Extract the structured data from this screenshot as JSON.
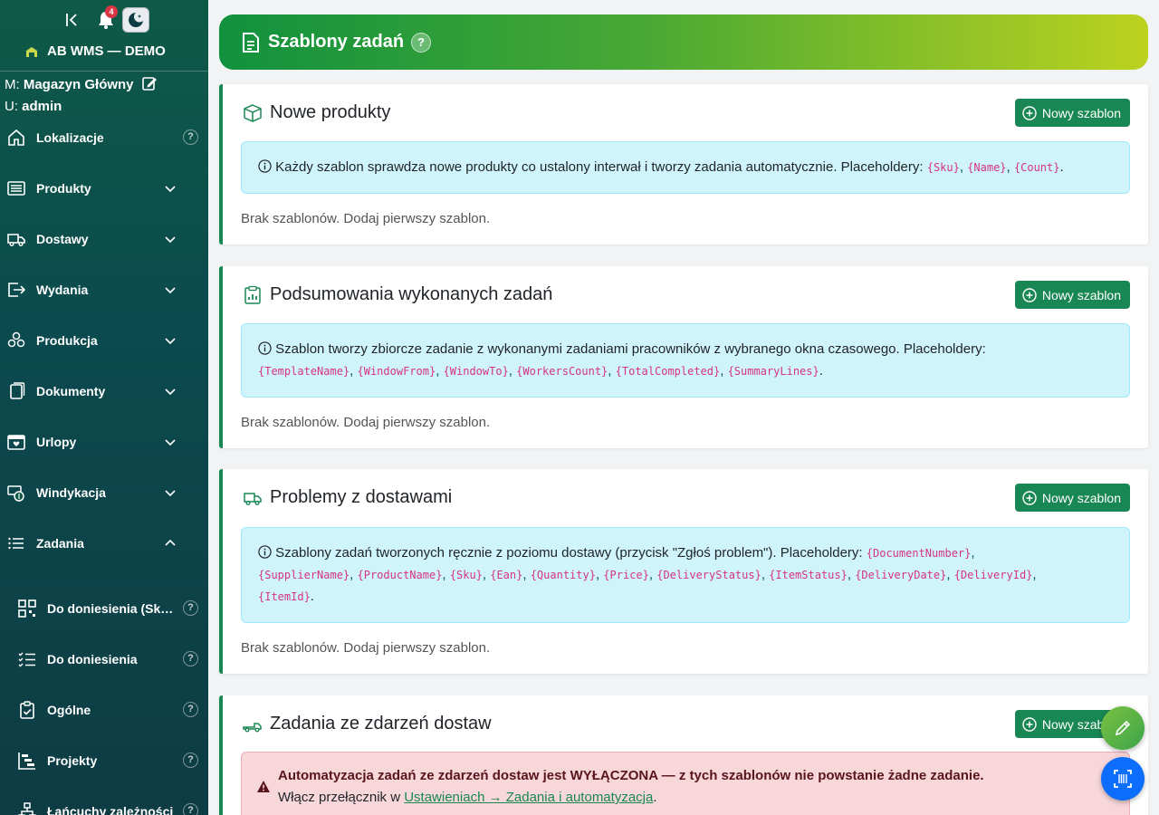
{
  "sidebar": {
    "notifications_count": "4",
    "brand": "AB WMS — DEMO",
    "warehouse_prefix": "M:",
    "warehouse": "Magazyn Główny",
    "user_prefix": "U:",
    "user": "admin",
    "items": [
      {
        "label": "Lokalizacje",
        "icon": "home-icon",
        "kind": "help"
      },
      {
        "label": "Produkty",
        "icon": "list-icon",
        "kind": "chevron-down"
      },
      {
        "label": "Dostawy",
        "icon": "truck-icon",
        "kind": "chevron-down"
      },
      {
        "label": "Wydania",
        "icon": "box-arrow-right-icon",
        "kind": "chevron-down"
      },
      {
        "label": "Produkcja",
        "icon": "boxes-icon",
        "kind": "chevron-down"
      },
      {
        "label": "Dokumenty",
        "icon": "files-icon",
        "kind": "chevron-down"
      },
      {
        "label": "Urlopy",
        "icon": "calendar-heart-icon",
        "kind": "chevron-down"
      },
      {
        "label": "Windykacja",
        "icon": "cash-coin-icon",
        "kind": "chevron-down"
      },
      {
        "label": "Zadania",
        "icon": "list-task-icon",
        "kind": "chevron-up"
      }
    ],
    "subitems": [
      {
        "label": "Do doniesienia (Sk…",
        "icon": "qr-code-icon"
      },
      {
        "label": "Do doniesienia",
        "icon": "checklist-icon"
      },
      {
        "label": "Ogólne",
        "icon": "clipboard-check-icon"
      },
      {
        "label": "Projekty",
        "icon": "bar-chart-steps-icon"
      },
      {
        "label": "Łańcuchy zależności",
        "icon": "diagram-icon"
      }
    ]
  },
  "header": {
    "title": "Szablony zadań",
    "help": "?"
  },
  "common": {
    "new_button": "Nowy szablon",
    "empty": "Brak szablonów. Dodaj pierwszy szablon."
  },
  "cards": [
    {
      "title": "Nowe produkty",
      "info_text": "Każdy szablon sprawdza nowe produkty co ustalony interwał i tworzy zadania automatycznie. Placeholdery: ",
      "placeholders": [
        "{Sku}",
        "{Name}",
        "{Count}"
      ]
    },
    {
      "title": "Podsumowania wykonanych zadań",
      "info_text": "Szablon tworzy zbiorcze zadanie z wykonanymi zadaniami pracowników z wybranego okna czasowego. Placeholdery: ",
      "placeholders": [
        "{TemplateName}",
        "{WindowFrom}",
        "{WindowTo}",
        "{WorkersCount}",
        "{TotalCompleted}",
        "{SummaryLines}"
      ]
    },
    {
      "title": "Problemy z dostawami",
      "info_text": "Szablony zadań tworzonych ręcznie z poziomu dostawy (przycisk \"Zgłoś problem\"). Placeholdery: ",
      "placeholders": [
        "{DocumentNumber}",
        "{SupplierName}",
        "{ProductName}",
        "{Sku}",
        "{Ean}",
        "{Quantity}",
        "{Price}",
        "{DeliveryStatus}",
        "{ItemStatus}",
        "{DeliveryDate}",
        "{DeliveryId}",
        "{ItemId}"
      ]
    },
    {
      "title": "Zadania ze zdarzeń dostaw",
      "alert_bold": "Automatyzacja zadań ze zdarzeń dostaw jest WYŁĄCZONA — z tych szablonów nie powstanie żadne zadanie.",
      "alert_prefix": "Włącz przełącznik w ",
      "alert_link": "Ustawieniach → Zadania i automatyzacja",
      "alert_suffix": "."
    }
  ],
  "colors": {
    "accent": "#198754",
    "info_bg": "#cff4fc",
    "danger_bg": "#f8d7da",
    "code": "#d63384"
  }
}
